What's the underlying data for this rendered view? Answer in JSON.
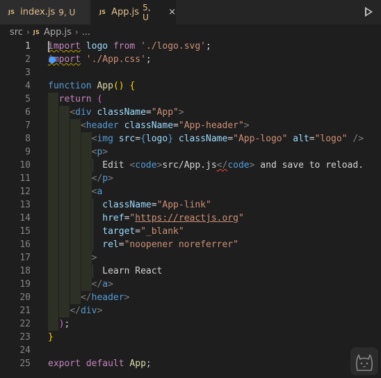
{
  "tabs": [
    {
      "badge": "JS",
      "name": "index.js",
      "mods": "9, U"
    },
    {
      "badge": "JS",
      "name": "App.js",
      "mods": "5, U",
      "close": "×"
    }
  ],
  "breadcrumb": {
    "folder": "src",
    "badge": "JS",
    "file": "App.js",
    "trail": "..."
  },
  "line_numbers": [
    "1",
    "2",
    "3",
    "4",
    "5",
    "6",
    "7",
    "8",
    "9",
    "10",
    "11",
    "12",
    "13",
    "14",
    "15",
    "16",
    "17",
    "18",
    "19",
    "20",
    "21",
    "22",
    "23",
    "24",
    "25"
  ],
  "code": {
    "l1": {
      "kw": "import",
      "name": "logo",
      "from": "from",
      "str": "'./logo.svg'",
      "end": ";"
    },
    "l2": {
      "kw": "import",
      "str": "'./App.css'",
      "end": ";"
    },
    "l4": {
      "kw": "function",
      "name": "App",
      "parens": "()",
      "brace": "{"
    },
    "l5": {
      "kw": "return",
      "paren": "("
    },
    "l6": {
      "open": "<",
      "tag": "div",
      "attr": "className",
      "eq": "=",
      "val": "\"App\"",
      "close": ">"
    },
    "l7": {
      "open": "<",
      "tag": "header",
      "attr": "className",
      "eq": "=",
      "val": "\"App-header\"",
      "close": ">"
    },
    "l8": {
      "open": "<",
      "tag": "img",
      "a1": "src",
      "eq1": "=",
      "b1": "{",
      "e1": "logo",
      "b2": "}",
      "a2": "className",
      "eq2": "=",
      "v2": "\"App-logo\"",
      "a3": "alt",
      "eq3": "=",
      "v3": "\"logo\"",
      "close": "/>"
    },
    "l9": {
      "open": "<",
      "tag": "p",
      "close": ">"
    },
    "l10": {
      "t1": "Edit ",
      "o1": "<",
      "tag1": "code",
      "c1": ">",
      "t2": "src/App.js",
      "o2": "</",
      "tag2": "code",
      "c2": ">",
      "t3": " and save to reload."
    },
    "l11": {
      "open": "</",
      "tag": "p",
      "close": ">"
    },
    "l12": {
      "open": "<",
      "tag": "a"
    },
    "l13": {
      "attr": "className",
      "eq": "=",
      "val": "\"App-link\""
    },
    "l14": {
      "attr": "href",
      "eq": "=",
      "q1": "\"",
      "url": "https://reactjs.org",
      "q2": "\""
    },
    "l15": {
      "attr": "target",
      "eq": "=",
      "val": "\"_blank\""
    },
    "l16": {
      "attr": "rel",
      "eq": "=",
      "val": "\"noopener noreferrer\""
    },
    "l17": {
      "close": ">"
    },
    "l18": {
      "text": "Learn React"
    },
    "l19": {
      "open": "</",
      "tag": "a",
      "close": ">"
    },
    "l20": {
      "open": "</",
      "tag": "header",
      "close": ">"
    },
    "l21": {
      "open": "</",
      "tag": "div",
      "close": ">"
    },
    "l22": {
      "paren": ")",
      "end": ";"
    },
    "l23": {
      "brace": "}"
    },
    "l25": {
      "kw1": "export",
      "kw2": "default",
      "name": "App",
      "end": ";"
    }
  },
  "colors": {
    "background": "#1e1e1e",
    "tabbar": "#252526",
    "modified": "#e2c08d"
  },
  "icons": {
    "run": "play-icon",
    "cat": "cat-logo-icon",
    "bulb": "lightbulb-icon"
  }
}
